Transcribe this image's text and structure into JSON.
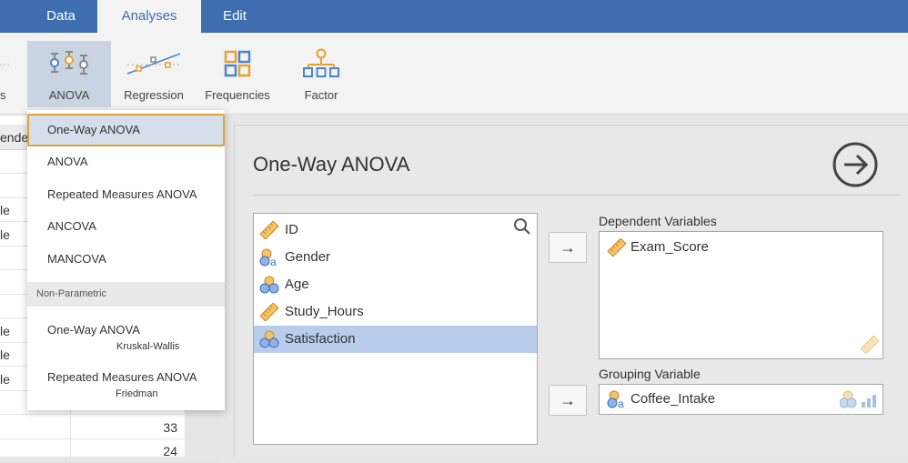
{
  "menubar": {
    "tabs": [
      {
        "label": "Data"
      },
      {
        "label": "Analyses"
      },
      {
        "label": "Edit"
      }
    ]
  },
  "ribbon": {
    "partial_label": "s",
    "buttons": [
      {
        "label": "ANOVA",
        "icon": "anova-icon"
      },
      {
        "label": "Regression",
        "icon": "regression-icon"
      },
      {
        "label": "Frequencies",
        "icon": "frequencies-icon"
      },
      {
        "label": "Factor",
        "icon": "factor-icon"
      }
    ]
  },
  "grid": {
    "header_partial": "ende",
    "rows": [
      {
        "a": "",
        "b": ""
      },
      {
        "a": "",
        "b": ""
      },
      {
        "a": "le",
        "b": ""
      },
      {
        "a": "le",
        "b": ""
      },
      {
        "a": "",
        "b": ""
      },
      {
        "a": "",
        "b": ""
      },
      {
        "a": "",
        "b": ""
      },
      {
        "a": "le",
        "b": ""
      },
      {
        "a": "le",
        "b": ""
      },
      {
        "a": "le",
        "b": ""
      },
      {
        "a": "",
        "b": ""
      },
      {
        "a": "",
        "b": "33"
      },
      {
        "a": "",
        "b": "24"
      }
    ]
  },
  "dropdown": {
    "items": [
      {
        "label": "One-Way ANOVA"
      },
      {
        "label": "ANOVA"
      },
      {
        "label": "Repeated Measures ANOVA"
      },
      {
        "label": "ANCOVA"
      },
      {
        "label": "MANCOVA"
      }
    ],
    "section": "Non-Parametric",
    "nonparametric": [
      {
        "label": "One-Way ANOVA",
        "sub": "Kruskal-Wallis"
      },
      {
        "label": "Repeated Measures ANOVA",
        "sub": "Friedman"
      }
    ]
  },
  "panel": {
    "title": "One-Way ANOVA",
    "variables": [
      {
        "name": "ID",
        "type": "continuous"
      },
      {
        "name": "Gender",
        "type": "nominal-text"
      },
      {
        "name": "Age",
        "type": "nominal"
      },
      {
        "name": "Study_Hours",
        "type": "continuous"
      },
      {
        "name": "Satisfaction",
        "type": "nominal"
      }
    ],
    "dependent_label": "Dependent Variables",
    "dependent_vars": [
      {
        "name": "Exam_Score"
      }
    ],
    "grouping_label": "Grouping Variable",
    "grouping_var": {
      "name": "Coffee_Intake"
    },
    "arrow_symbol": "→"
  },
  "colors": {
    "menubar": "#3e6eb0",
    "highlight": "#b8ccec",
    "selected_border": "#e0a23a",
    "ruler": "#e8b04a",
    "nominal_blue": "#4a84d4"
  }
}
